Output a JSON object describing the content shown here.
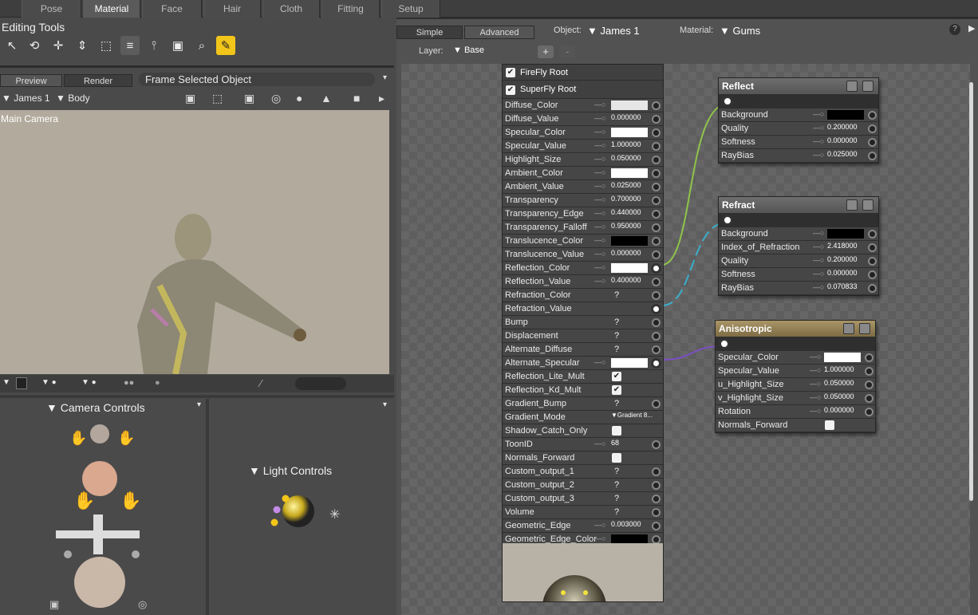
{
  "rooms": [
    "Pose",
    "Material",
    "Face",
    "Hair",
    "Cloth",
    "Fitting",
    "Setup"
  ],
  "active_room": "Material",
  "editing_tools": {
    "title": "Editing Tools"
  },
  "preview_tabs": {
    "preview": "Preview",
    "render": "Render",
    "frame": "Frame Selected Object"
  },
  "figure_selector": {
    "figure": "James 1",
    "part": "Body"
  },
  "viewport": {
    "camera": "Main Camera"
  },
  "camera_controls": {
    "title": "Camera Controls"
  },
  "light_controls": {
    "title": "Light Controls"
  },
  "mat": {
    "tabs": {
      "simple": "Simple",
      "advanced": "Advanced"
    },
    "object_label": "Object:",
    "object": "James 1",
    "material_label": "Material:",
    "material": "Gums",
    "layer_label": "Layer:",
    "layer": "Base",
    "help": "?",
    "add": "+",
    "remove": "-"
  },
  "root": {
    "firefly": "FireFly Root",
    "superfly": "SuperFly Root",
    "rows": [
      {
        "label": "Diffuse_Color",
        "kind": "color",
        "color": "#e6e6e6"
      },
      {
        "label": "Diffuse_Value",
        "kind": "num",
        "value": "0.000000"
      },
      {
        "label": "Specular_Color",
        "kind": "color",
        "color": "#ffffff"
      },
      {
        "label": "Specular_Value",
        "kind": "num",
        "value": "1.000000"
      },
      {
        "label": "Highlight_Size",
        "kind": "num",
        "value": "0.050000"
      },
      {
        "label": "Ambient_Color",
        "kind": "color",
        "color": "#ffffff"
      },
      {
        "label": "Ambient_Value",
        "kind": "num",
        "value": "0.025000"
      },
      {
        "label": "Transparency",
        "kind": "num",
        "value": "0.700000"
      },
      {
        "label": "Transparency_Edge",
        "kind": "num",
        "value": "0.440000"
      },
      {
        "label": "Transparency_Falloff",
        "kind": "num",
        "value": "0.950000"
      },
      {
        "label": "Translucence_Color",
        "kind": "color",
        "color": "#000000"
      },
      {
        "label": "Translucence_Value",
        "kind": "num",
        "value": "0.000000"
      },
      {
        "label": "Reflection_Color",
        "kind": "color",
        "color": "#ffffff",
        "linked": true
      },
      {
        "label": "Reflection_Value",
        "kind": "num",
        "value": "0.400000"
      },
      {
        "label": "Refraction_Color",
        "kind": "q"
      },
      {
        "label": "Refraction_Value",
        "kind": "none",
        "linked": true
      },
      {
        "label": "Bump",
        "kind": "q"
      },
      {
        "label": "Displacement",
        "kind": "q"
      },
      {
        "label": "Alternate_Diffuse",
        "kind": "q"
      },
      {
        "label": "Alternate_Specular",
        "kind": "color",
        "color": "#ffffff",
        "linked": true
      },
      {
        "label": "Reflection_Lite_Mult",
        "kind": "check",
        "checked": true
      },
      {
        "label": "Reflection_Kd_Mult",
        "kind": "check",
        "checked": true
      },
      {
        "label": "Gradient_Bump",
        "kind": "q"
      },
      {
        "label": "Gradient_Mode",
        "kind": "menu",
        "value": "Gradient 8..."
      },
      {
        "label": "Shadow_Catch_Only",
        "kind": "check",
        "checked": false
      },
      {
        "label": "ToonID",
        "kind": "num",
        "value": "68"
      },
      {
        "label": "Normals_Forward",
        "kind": "check",
        "checked": false
      },
      {
        "label": "Custom_output_1",
        "kind": "q"
      },
      {
        "label": "Custom_output_2",
        "kind": "q"
      },
      {
        "label": "Custom_output_3",
        "kind": "q"
      },
      {
        "label": "Volume",
        "kind": "q"
      },
      {
        "label": "Geometric_Edge",
        "kind": "num",
        "value": "0.003000"
      },
      {
        "label": "Geometric_Edge_Color",
        "kind": "color",
        "color": "#000000"
      }
    ]
  },
  "nodes": {
    "reflect": {
      "title": "Reflect",
      "rows": [
        {
          "label": "Background",
          "kind": "color",
          "color": "#000000"
        },
        {
          "label": "Quality",
          "kind": "num",
          "value": "0.200000"
        },
        {
          "label": "Softness",
          "kind": "num",
          "value": "0.000000"
        },
        {
          "label": "RayBias",
          "kind": "num",
          "value": "0.025000"
        }
      ]
    },
    "refract": {
      "title": "Refract",
      "rows": [
        {
          "label": "Background",
          "kind": "color",
          "color": "#000000"
        },
        {
          "label": "Index_of_Refraction",
          "kind": "num",
          "value": "2.418000"
        },
        {
          "label": "Quality",
          "kind": "num",
          "value": "0.200000"
        },
        {
          "label": "Softness",
          "kind": "num",
          "value": "0.000000"
        },
        {
          "label": "RayBias",
          "kind": "num",
          "value": "0.070833"
        }
      ]
    },
    "aniso": {
      "title": "Anisotropic",
      "rows": [
        {
          "label": "Specular_Color",
          "kind": "color",
          "color": "#ffffff"
        },
        {
          "label": "Specular_Value",
          "kind": "num",
          "value": "1.000000"
        },
        {
          "label": "u_Highlight_Size",
          "kind": "num",
          "value": "0.050000"
        },
        {
          "label": "v_Highlight_Size",
          "kind": "num",
          "value": "0.050000"
        },
        {
          "label": "Rotation",
          "kind": "num",
          "value": "0.000000"
        },
        {
          "label": "Normals_Forward",
          "kind": "check",
          "checked": false
        }
      ]
    }
  },
  "colors": {
    "accent": "#f2c51a",
    "link_green": "#8fc44a",
    "link_cyan": "#3aaecb",
    "link_purple": "#7b4fc2",
    "aniso_head": "#a99567"
  }
}
